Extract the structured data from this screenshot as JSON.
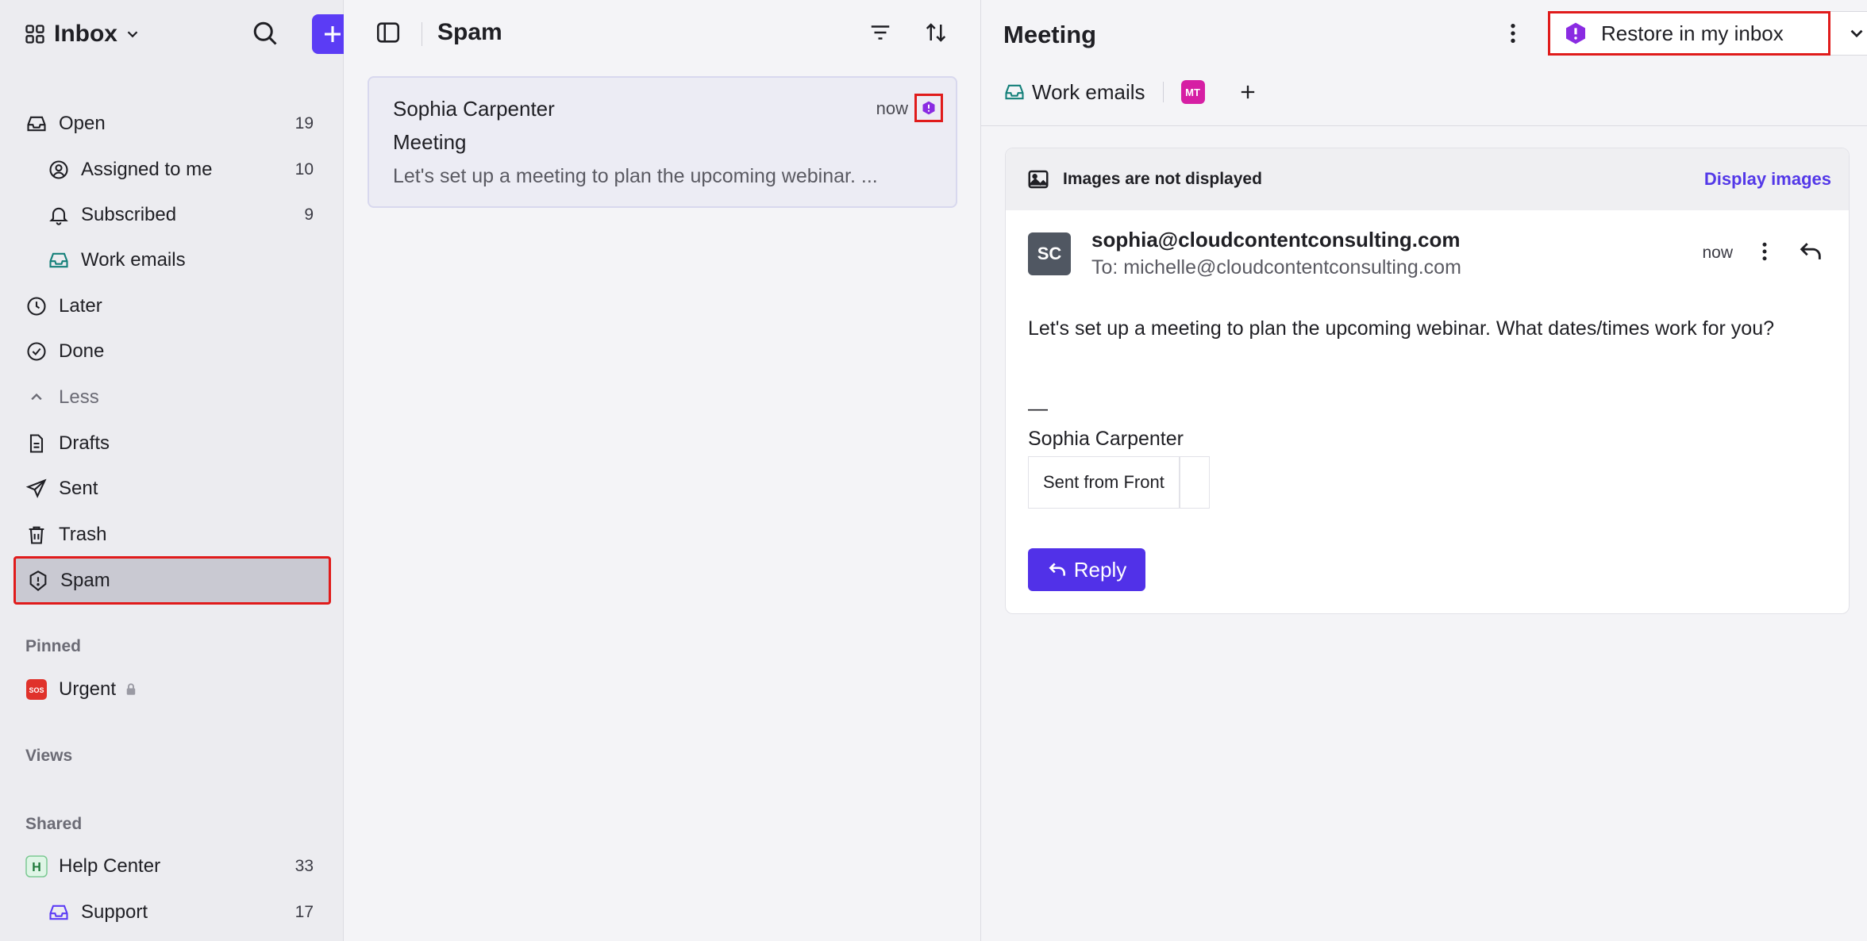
{
  "sidebar": {
    "workspace": "Inbox",
    "nav": [
      {
        "label": "Open",
        "count": "19"
      },
      {
        "label": "Assigned to me",
        "count": "10"
      },
      {
        "label": "Subscribed",
        "count": "9"
      },
      {
        "label": "Work emails",
        "count": ""
      },
      {
        "label": "Later",
        "count": ""
      },
      {
        "label": "Done",
        "count": ""
      },
      {
        "label": "Less",
        "count": ""
      },
      {
        "label": "Drafts",
        "count": ""
      },
      {
        "label": "Sent",
        "count": ""
      },
      {
        "label": "Trash",
        "count": ""
      },
      {
        "label": "Spam",
        "count": ""
      }
    ],
    "pinned_label": "Pinned",
    "pinned": [
      {
        "label": "Urgent"
      }
    ],
    "views_label": "Views",
    "shared_label": "Shared",
    "shared": [
      {
        "label": "Help Center",
        "count": "33",
        "badge": "H"
      },
      {
        "label": "Support",
        "count": "17"
      }
    ]
  },
  "list": {
    "title": "Spam",
    "conversation": {
      "from": "Sophia Carpenter",
      "time": "now",
      "subject": "Meeting",
      "snippet": "Let's set up a meeting to plan the upcoming webinar. ..."
    }
  },
  "detail": {
    "title": "Meeting",
    "restore_label": "Restore in my inbox",
    "tag_inbox": "Work emails",
    "tag_badge": "MT",
    "images_notice": "Images are not displayed",
    "display_images": "Display images",
    "avatar_initials": "SC",
    "from": "sophia@cloudcontentconsulting.com",
    "to": "To: michelle@cloudcontentconsulting.com",
    "time": "now",
    "body": "Let's set up a meeting to plan the upcoming webinar. What dates/times work for you?",
    "sig_dash": "—",
    "sig_name": "Sophia Carpenter",
    "sig_cell": "Sent from Front",
    "reply_label": "Reply"
  },
  "colors": {
    "accent": "#5b3cf5",
    "highlight_border": "#e01b1b",
    "spam_purple": "#8a2be2",
    "mt_badge": "#d61fa4",
    "link": "#5338e8"
  }
}
